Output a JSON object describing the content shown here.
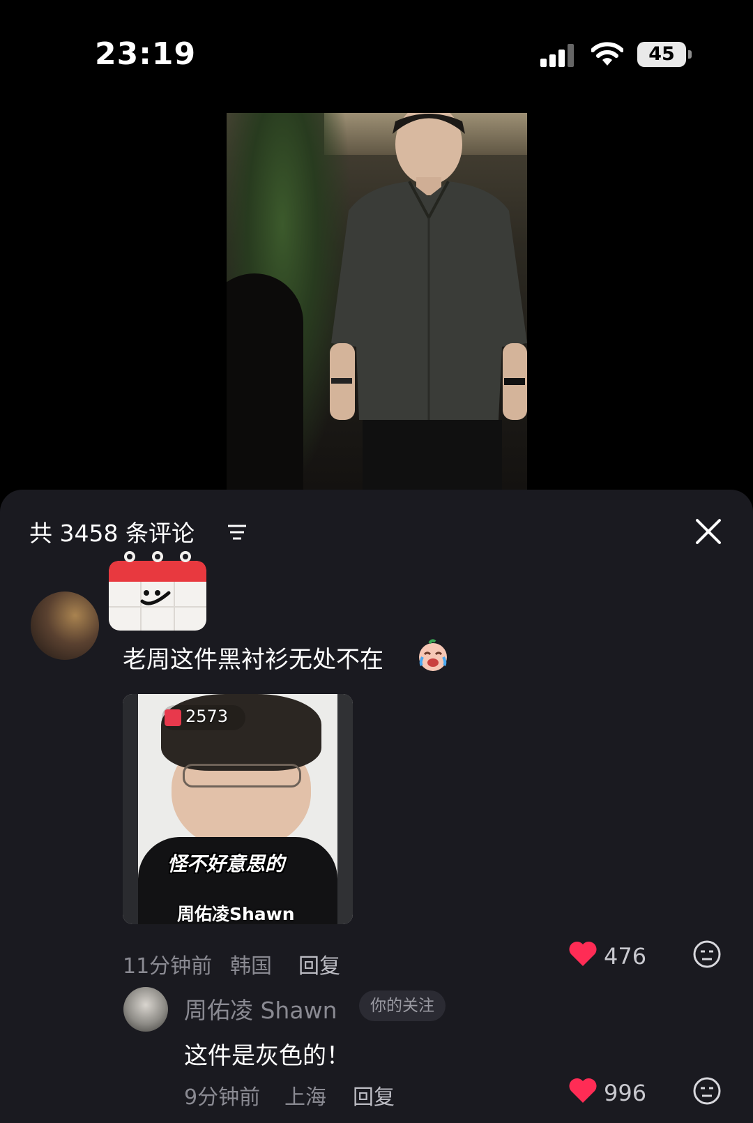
{
  "status_bar": {
    "time": "23:19",
    "battery": "45"
  },
  "comments_header": {
    "title": "共 3458 条评论"
  },
  "comment": {
    "text": "老周这件黑衬衫无处不在",
    "media": {
      "gift_count": "2573",
      "caption": "怪不好意思的",
      "author_watermark": "周佑凌Shawn"
    },
    "time": "11分钟前",
    "location": "韩国",
    "reply_label": "回复",
    "likes": "476"
  },
  "reply": {
    "username": "周佑凌 Shawn",
    "badge": "你的关注",
    "text": "这件是灰色的！",
    "time": "9分钟前",
    "location": "上海",
    "reply_label": "回复",
    "likes": "996"
  },
  "colors": {
    "sheet_bg": "#1a1a20",
    "like_heart": "#ff2c55",
    "muted_text": "#8a8a92"
  }
}
